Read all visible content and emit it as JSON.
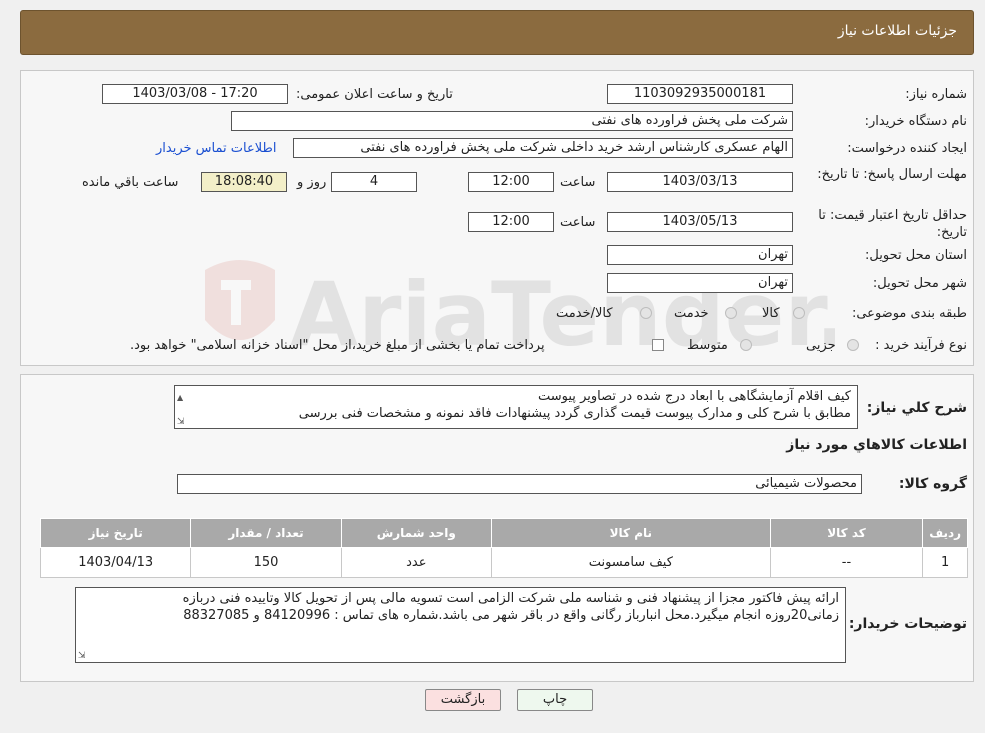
{
  "header": {
    "title": "جزئیات اطلاعات نیاز"
  },
  "fields": {
    "need_number_label": "شماره نیاز:",
    "need_number": "1103092935000181",
    "announce_label": "تاریخ و ساعت اعلان عمومی:",
    "announce_value": "1403/03/08 - 17:20",
    "buyer_org_label": "نام دستگاه خریدار:",
    "buyer_org": "شرکت ملی پخش فراورده های نفتی",
    "creator_label": "ایجاد کننده درخواست:",
    "creator": "الهام عسکری کارشناس ارشد خرید داخلی شرکت ملی پخش فراورده های نفتی",
    "contact_link": "اطلاعات تماس خریدار",
    "deadline_label": "مهلت ارسال پاسخ: تا تاریخ:",
    "deadline_date": "1403/03/13",
    "hour_label": "ساعت",
    "deadline_time": "12:00",
    "days_value": "4",
    "days_label": "روز و",
    "remaining_time": "18:08:40",
    "remaining_label": "ساعت باقي مانده",
    "validity_label": "حداقل تاریخ اعتبار قیمت: تا تاریخ:",
    "validity_date": "1403/05/13",
    "validity_hour_label": "ساعت",
    "validity_time": "12:00",
    "province_label": "استان محل تحویل:",
    "province": "تهران",
    "city_label": "شهر محل تحویل:",
    "city": "تهران",
    "category_label": "طبقه بندی موضوعی:",
    "category_options": [
      "کالا",
      "خدمت",
      "کالا/خدمت"
    ],
    "process_label": "نوع فرآیند خرید :",
    "process_options": [
      "جزیی",
      "متوسط"
    ],
    "process_note": "پرداخت تمام یا بخشی از مبلغ خرید،از محل \"اسناد خزانه اسلامی\" خواهد بود."
  },
  "description": {
    "label": "شرح کلي نياز:",
    "lines": [
      "کیف اقلام آزمایشگاهی با ابعاد درج شده در تصاویر پیوست",
      "مطابق با شرح کلی و مدارک پیوست قیمت گذاری گردد پیشنهادات فاقد نمونه و مشخصات فنی بررسی"
    ]
  },
  "goods": {
    "section_title": "اطلاعات کالاهاي مورد نياز",
    "group_label": "گروه کالا:",
    "group_value": "محصولات شیمیائی",
    "columns": [
      "رديف",
      "کد کالا",
      "نام کالا",
      "واحد شمارش",
      "تعداد / مقدار",
      "تاريخ نياز"
    ],
    "rows": [
      [
        "1",
        "--",
        "کیف سامسونت",
        "عدد",
        "150",
        "1403/04/13"
      ]
    ]
  },
  "buyer_notes": {
    "label": "توضيحات خريدار:",
    "lines": [
      "ارائه پیش فاکتور مجزا از پیشنهاد فنی و شناسه ملی شرکت الزامی است تسویه مالی پس از تحویل کالا وتاییده فنی دربازه",
      "زمانی20روزه انجام میگیرد.محل انبارباز رگانی واقع در باقر شهر می باشد.شماره های تماس : 84120996 و 88327085"
    ]
  },
  "buttons": {
    "print": "چاپ",
    "back": "بازگشت"
  },
  "watermark": {
    "text": "AriaTender.neT"
  },
  "colors": {
    "header": "#8b6b3f",
    "link": "#1a4fd1",
    "table_header": "#a9a9a9"
  }
}
